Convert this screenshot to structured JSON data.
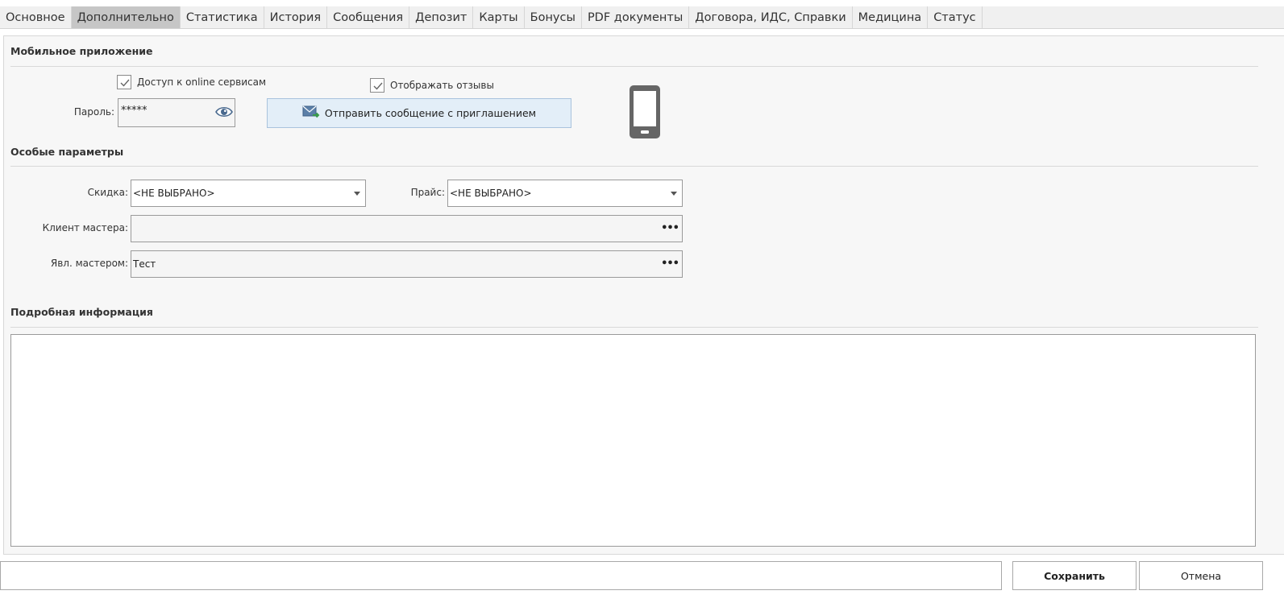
{
  "tabs": [
    {
      "label": "Основное",
      "active": false
    },
    {
      "label": "Дополнительно",
      "active": true
    },
    {
      "label": "Статистика",
      "active": false
    },
    {
      "label": "История",
      "active": false
    },
    {
      "label": "Сообщения",
      "active": false
    },
    {
      "label": "Депозит",
      "active": false
    },
    {
      "label": "Карты",
      "active": false
    },
    {
      "label": "Бонусы",
      "active": false
    },
    {
      "label": "PDF документы",
      "active": false
    },
    {
      "label": "Договора, ИДС, Справки",
      "active": false
    },
    {
      "label": "Медицина",
      "active": false
    },
    {
      "label": "Статус",
      "active": false
    }
  ],
  "mobile": {
    "section_title": "Мобильное приложение",
    "online_access_label": "Доступ к online сервисам",
    "online_access_checked": true,
    "show_reviews_label": "Отображать отзывы",
    "show_reviews_checked": true,
    "password_label": "Пароль:",
    "password_value": "*****",
    "invite_button_label": "Отправить сообщение с приглашением"
  },
  "special": {
    "section_title": "Особые параметры",
    "discount_label": "Скидка:",
    "discount_value": "<НЕ ВЫБРАНО>",
    "price_label": "Прайс:",
    "price_value": "<НЕ ВЫБРАНО>",
    "master_client_label": "Клиент мастера:",
    "master_client_value": "",
    "is_master_label": "Явл. мастером:",
    "is_master_value": "Тест"
  },
  "details": {
    "section_title": "Подробная информация",
    "text": ""
  },
  "footer": {
    "status_text": "",
    "save_label": "Сохранить",
    "cancel_label": "Отмена"
  },
  "colors": {
    "active_tab": "#c6c6c6",
    "invite_button_bg": "#e3eef8",
    "panel_bg": "#f7f7f7"
  },
  "icons": {
    "eye": "eye-icon",
    "mail": "mail-send-icon",
    "phone": "mobile-phone-icon",
    "check": "check-icon",
    "dropdown": "chevron-down-icon",
    "ellipsis": "ellipsis-icon"
  }
}
